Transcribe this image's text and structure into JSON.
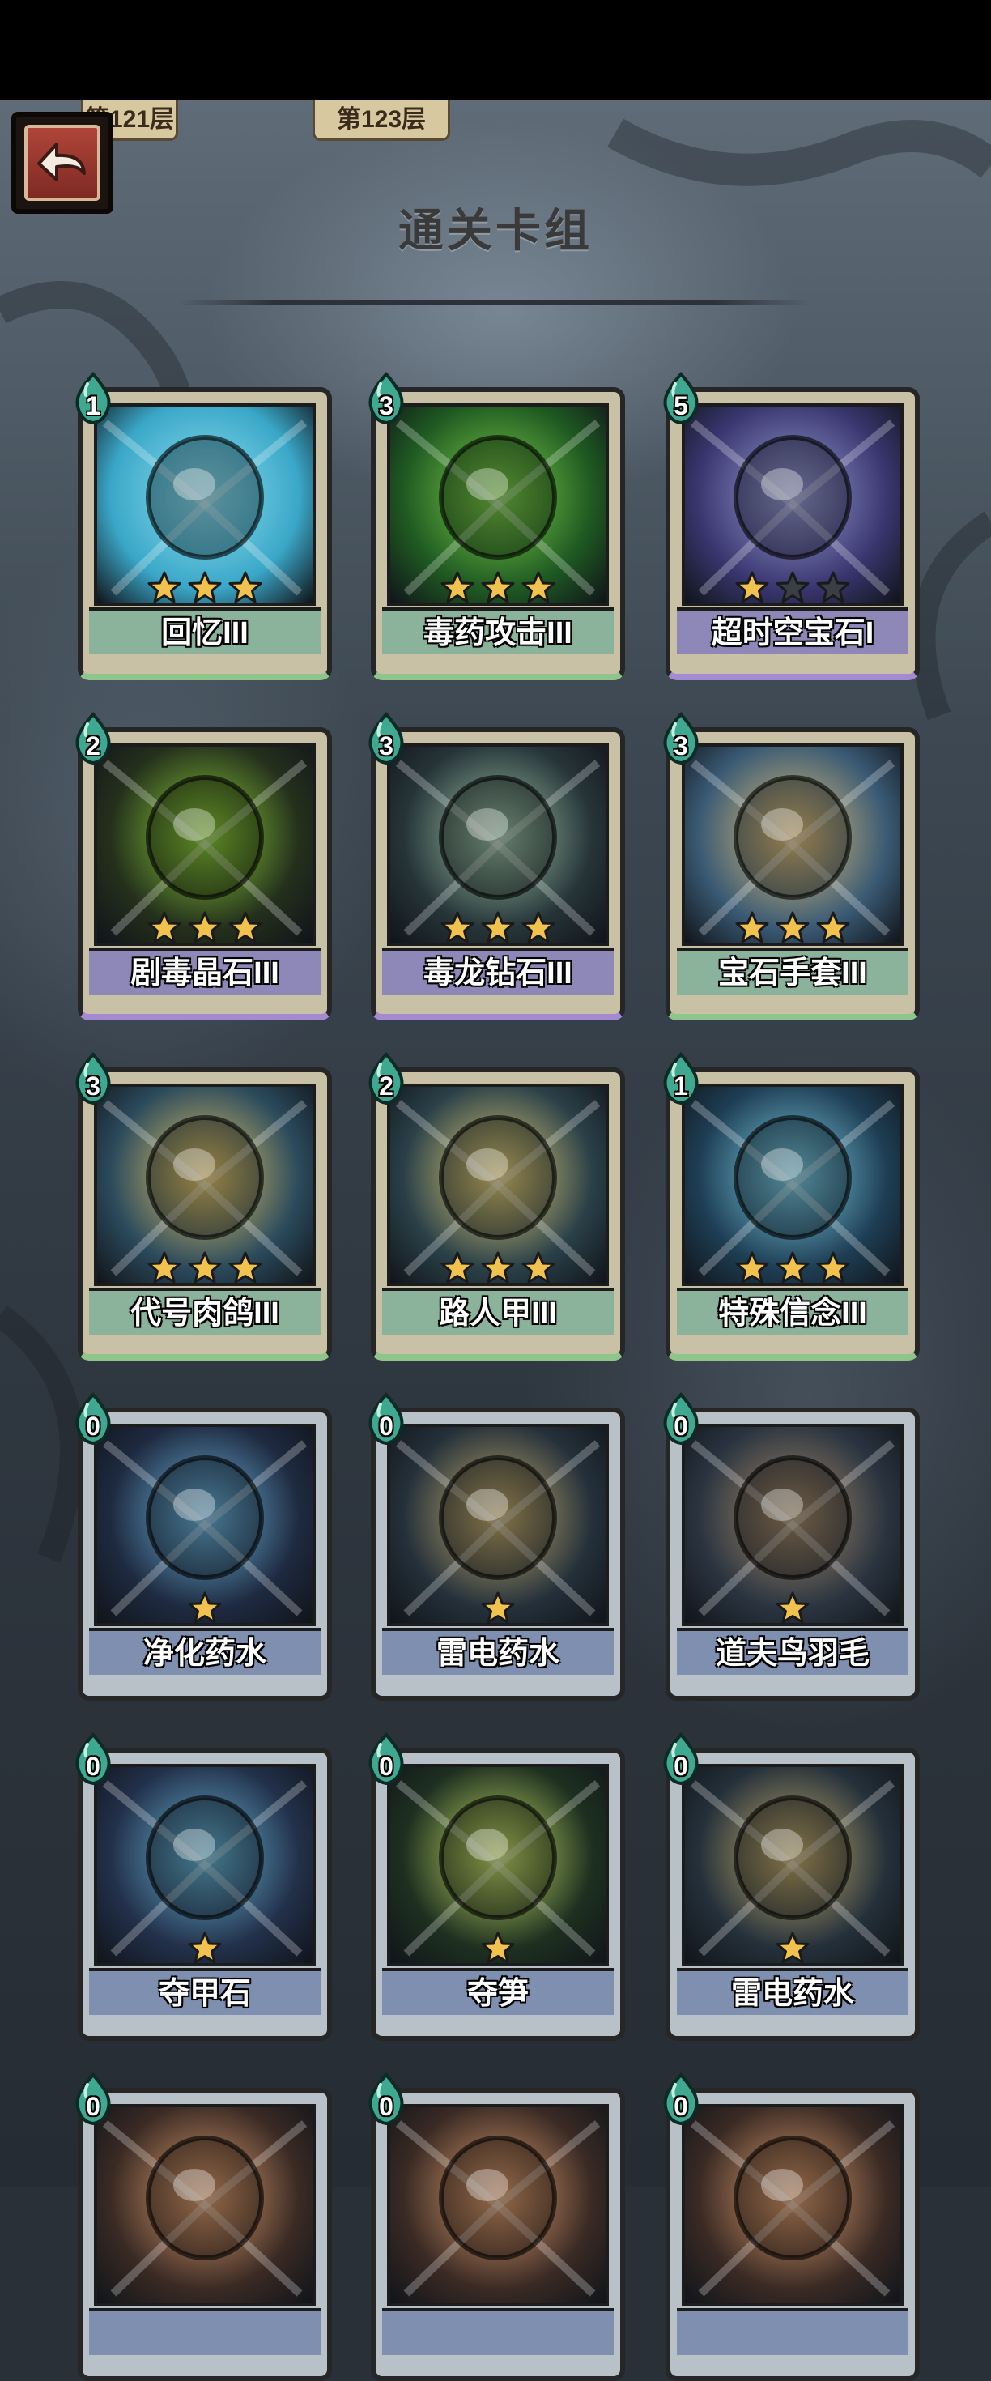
{
  "header": {
    "floor_tabs": [
      "第121层",
      "第123层"
    ],
    "title": "通关卡组"
  },
  "colors": {
    "label_green": "#8bb29a",
    "label_purple": "#8d88b8",
    "label_blue": "#7f8fb0",
    "star_gold": "#f2c24e",
    "star_empty": "#3a3f46"
  },
  "cards": [
    {
      "name": "回忆III",
      "cost": "1",
      "stars": 3,
      "max_stars": 3,
      "rarity": "green",
      "icon": "memory-icon"
    },
    {
      "name": "毒药攻击III",
      "cost": "3",
      "stars": 3,
      "max_stars": 3,
      "rarity": "green",
      "icon": "poison-attack-icon"
    },
    {
      "name": "超时空宝石I",
      "cost": "5",
      "stars": 1,
      "max_stars": 3,
      "rarity": "purple",
      "icon": "spacetime-gem-icon"
    },
    {
      "name": "剧毒晶石III",
      "cost": "2",
      "stars": 3,
      "max_stars": 3,
      "rarity": "purple",
      "icon": "toxic-crystal-icon"
    },
    {
      "name": "毒龙钻石III",
      "cost": "3",
      "stars": 3,
      "max_stars": 3,
      "rarity": "purple",
      "icon": "dragon-diamond-icon"
    },
    {
      "name": "宝石手套III",
      "cost": "3",
      "stars": 3,
      "max_stars": 3,
      "rarity": "green",
      "icon": "gem-gauntlet-icon"
    },
    {
      "name": "代号肉鸽III",
      "cost": "3",
      "stars": 3,
      "max_stars": 3,
      "rarity": "green",
      "icon": "codename-roguelike-icon"
    },
    {
      "name": "路人甲III",
      "cost": "2",
      "stars": 3,
      "max_stars": 3,
      "rarity": "green",
      "icon": "passerby-icon"
    },
    {
      "name": "特殊信念III",
      "cost": "1",
      "stars": 3,
      "max_stars": 3,
      "rarity": "green",
      "icon": "special-belief-icon"
    },
    {
      "name": "净化药水",
      "cost": "0",
      "stars": 1,
      "max_stars": 1,
      "rarity": "blue",
      "icon": "purify-potion-icon"
    },
    {
      "name": "雷电药水",
      "cost": "0",
      "stars": 1,
      "max_stars": 1,
      "rarity": "blue",
      "icon": "thunder-potion-icon"
    },
    {
      "name": "道夫鸟羽毛",
      "cost": "0",
      "stars": 1,
      "max_stars": 1,
      "rarity": "blue",
      "icon": "dodo-feather-icon"
    },
    {
      "name": "夺甲石",
      "cost": "0",
      "stars": 1,
      "max_stars": 1,
      "rarity": "blue",
      "icon": "armor-steal-stone-icon"
    },
    {
      "name": "夺笋",
      "cost": "0",
      "stars": 1,
      "max_stars": 1,
      "rarity": "blue",
      "icon": "bamboo-shoot-icon"
    },
    {
      "name": "雷电药水",
      "cost": "0",
      "stars": 1,
      "max_stars": 1,
      "rarity": "blue",
      "icon": "thunder-potion-icon"
    },
    {
      "name": "",
      "cost": "0",
      "stars": 0,
      "max_stars": 0,
      "rarity": "blue",
      "icon": "partial-card-icon"
    },
    {
      "name": "",
      "cost": "0",
      "stars": 0,
      "max_stars": 0,
      "rarity": "blue",
      "icon": "partial-card-icon"
    },
    {
      "name": "",
      "cost": "0",
      "stars": 0,
      "max_stars": 0,
      "rarity": "blue",
      "icon": "partial-card-icon"
    }
  ]
}
